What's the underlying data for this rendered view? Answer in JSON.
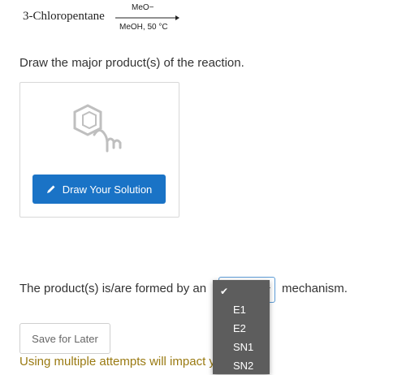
{
  "reaction": {
    "reactant": "3-Chloropentane",
    "reagent_top": "MeO−",
    "reagent_bottom": "MeOH, 50 °C"
  },
  "question": "Draw the major product(s) of the reaction.",
  "draw_area": {
    "button_label": "Draw Your Solution",
    "icon": "molecule-drawing-icon"
  },
  "mechanism": {
    "text_before": "The product(s) is/are formed by an",
    "text_after": "mechanism.",
    "selected": "",
    "options": [
      "",
      "E1",
      "E2",
      "SN1",
      "SN2"
    ]
  },
  "save_label": "Save for Later",
  "attempts_note": "Using multiple attempts will impact your score.",
  "colors": {
    "primary_button": "#1a73c6",
    "warning_text": "#9a7a12",
    "menu_bg": "#5d5d5d",
    "select_border": "#5b9bd5"
  }
}
